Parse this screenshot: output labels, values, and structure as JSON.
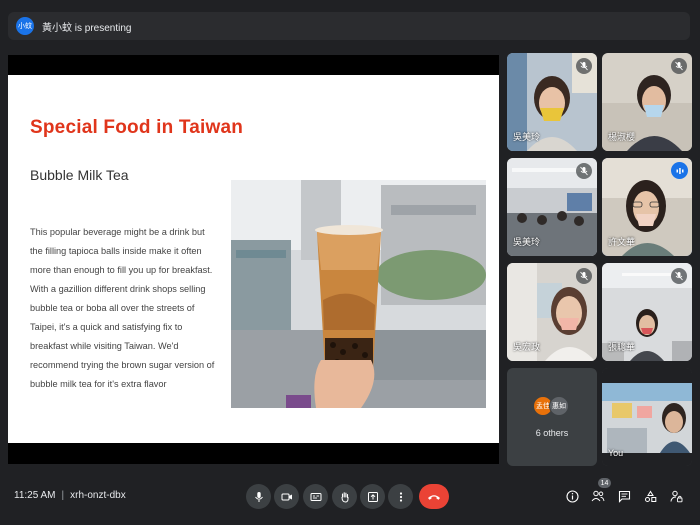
{
  "presenter": {
    "avatar_text": "小蚊",
    "text": "黃小蚊 is presenting"
  },
  "slide": {
    "title": "Special Food in Taiwan",
    "subtitle": "Bubble Milk Tea",
    "body": "This popular beverage might be a drink but the filling tapioca balls inside make it often more than enough to fill you up for breakfast. With a gazillion different drink shops selling bubble tea or boba all over the streets of Taipei, it's a quick and satisfying fix to breakfast while visiting Taiwan. We'd recommend trying the brown sugar version of bubble milk tea for it's extra flavor"
  },
  "participants": [
    {
      "name": "吳美玲",
      "mic": "off"
    },
    {
      "name": "楊淑櫻",
      "mic": "off"
    },
    {
      "name": "吳美玲",
      "mic": "off"
    },
    {
      "name": "許文華",
      "mic": "on"
    },
    {
      "name": "吳宏政",
      "mic": "off"
    },
    {
      "name": "張聰華",
      "mic": "off"
    }
  ],
  "others": {
    "avatars": [
      "孟佳",
      "惠如"
    ],
    "label": "6 others"
  },
  "self": {
    "name": "You"
  },
  "bottom": {
    "time": "11:25 AM",
    "meeting_code": "xrh-onzt-dbx",
    "people_count": "14"
  },
  "colors": {
    "background": "#202124",
    "accent": "#1a73e8",
    "end_call": "#ea4335",
    "slide_title": "#e0351b"
  }
}
